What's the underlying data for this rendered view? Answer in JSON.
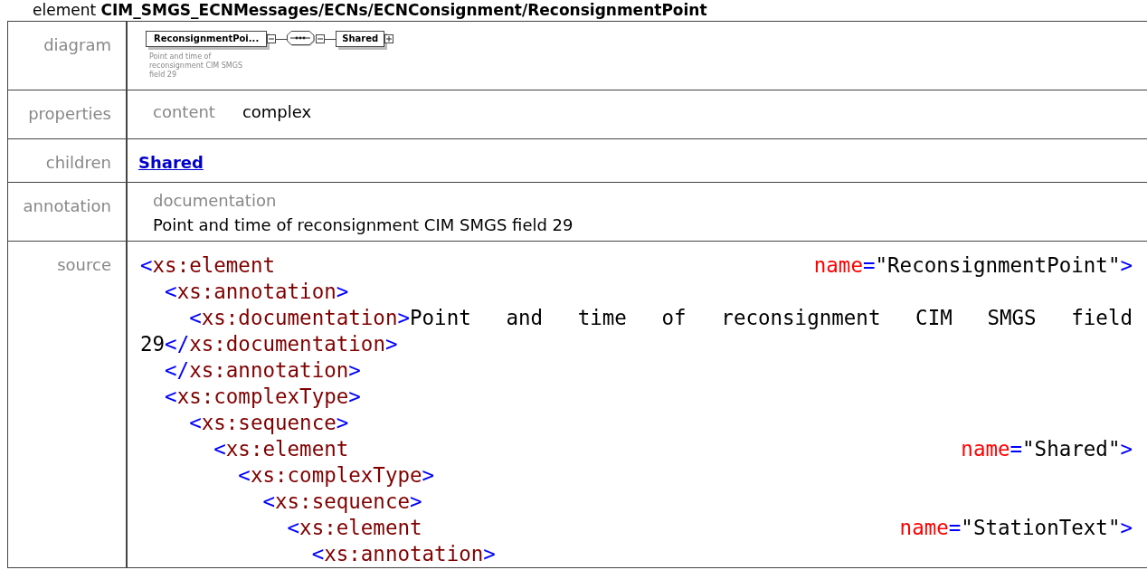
{
  "heading": {
    "kind_label": "element",
    "path": "CIM_SMGS_ECNMessages/ECNs/ECNConsignment/ReconsignmentPoint"
  },
  "rows": [
    {
      "kind": "diagram",
      "label": "diagram",
      "element": {
        "name": "ReconsignmentPoi...",
        "doc": "Point and time of reconsignment CIM SMGS field 29",
        "expanded": true
      },
      "sequence": {
        "expanded": true
      },
      "child": {
        "name": "Shared",
        "expanded": false
      }
    },
    {
      "kind": "properties",
      "label": "properties",
      "items": [
        {
          "key": "content",
          "value": "complex"
        }
      ]
    },
    {
      "kind": "children",
      "label": "children",
      "links": [
        "Shared"
      ]
    },
    {
      "kind": "annotation",
      "label": "annotation",
      "title": "documentation",
      "text": "Point and time of reconsignment CIM SMGS field 29"
    },
    {
      "kind": "source",
      "label": "source",
      "lines": [
        {
          "spread": true,
          "tokens": [
            {
              "kind": "bracket",
              "text": "<"
            },
            {
              "kind": "tag",
              "text": "xs:element"
            },
            {
              "kind": "attr",
              "text": "name"
            },
            {
              "kind": "bracket",
              "text": "="
            },
            {
              "kind": "value",
              "text": "\"ReconsignmentPoint\""
            },
            {
              "kind": "bracket",
              "text": ">"
            }
          ],
          "children": [
            {
              "spread": false,
              "tokens": [
                {
                  "kind": "bracket",
                  "text": "<"
                },
                {
                  "kind": "tag",
                  "text": "xs:annotation"
                },
                {
                  "kind": "bracket",
                  "text": ">"
                }
              ],
              "children": [
                {
                  "spread": true,
                  "tokens": [
                    {
                      "kind": "bracket",
                      "text": "<"
                    },
                    {
                      "kind": "tag",
                      "text": "xs:documentation"
                    },
                    {
                      "kind": "bracket",
                      "text": ">"
                    },
                    {
                      "kind": "value",
                      "text": "Point and time of reconsignment CIM SMGS field"
                    }
                  ],
                  "continuation": [
                    {
                      "kind": "value",
                      "text": "29"
                    },
                    {
                      "kind": "bracket",
                      "text": "</"
                    },
                    {
                      "kind": "tag",
                      "text": "xs:documentation"
                    },
                    {
                      "kind": "bracket",
                      "text": ">"
                    }
                  ]
                }
              ]
            },
            {
              "spread": false,
              "tokens": [
                {
                  "kind": "bracket",
                  "text": "</"
                },
                {
                  "kind": "tag",
                  "text": "xs:annotation"
                },
                {
                  "kind": "bracket",
                  "text": ">"
                }
              ]
            },
            {
              "spread": false,
              "tokens": [
                {
                  "kind": "bracket",
                  "text": "<"
                },
                {
                  "kind": "tag",
                  "text": "xs:complexType"
                },
                {
                  "kind": "bracket",
                  "text": ">"
                }
              ],
              "children": [
                {
                  "spread": false,
                  "tokens": [
                    {
                      "kind": "bracket",
                      "text": "<"
                    },
                    {
                      "kind": "tag",
                      "text": "xs:sequence"
                    },
                    {
                      "kind": "bracket",
                      "text": ">"
                    }
                  ],
                  "children": [
                    {
                      "spread": true,
                      "tokens": [
                        {
                          "kind": "bracket",
                          "text": "<"
                        },
                        {
                          "kind": "tag",
                          "text": "xs:element"
                        },
                        {
                          "kind": "attr",
                          "text": "name"
                        },
                        {
                          "kind": "bracket",
                          "text": "="
                        },
                        {
                          "kind": "value",
                          "text": "\"Shared\""
                        },
                        {
                          "kind": "bracket",
                          "text": ">"
                        }
                      ],
                      "children": [
                        {
                          "spread": false,
                          "tokens": [
                            {
                              "kind": "bracket",
                              "text": "<"
                            },
                            {
                              "kind": "tag",
                              "text": "xs:complexType"
                            },
                            {
                              "kind": "bracket",
                              "text": ">"
                            }
                          ],
                          "children": [
                            {
                              "spread": false,
                              "tokens": [
                                {
                                  "kind": "bracket",
                                  "text": "<"
                                },
                                {
                                  "kind": "tag",
                                  "text": "xs:sequence"
                                },
                                {
                                  "kind": "bracket",
                                  "text": ">"
                                }
                              ],
                              "children": [
                                {
                                  "spread": true,
                                  "tokens": [
                                    {
                                      "kind": "bracket",
                                      "text": "<"
                                    },
                                    {
                                      "kind": "tag",
                                      "text": "xs:element"
                                    },
                                    {
                                      "kind": "attr",
                                      "text": "name"
                                    },
                                    {
                                      "kind": "bracket",
                                      "text": "="
                                    },
                                    {
                                      "kind": "value",
                                      "text": "\"StationText\""
                                    },
                                    {
                                      "kind": "bracket",
                                      "text": ">"
                                    }
                                  ],
                                  "children": [
                                    {
                                      "spread": false,
                                      "tokens": [
                                        {
                                          "kind": "bracket",
                                          "text": "<"
                                        },
                                        {
                                          "kind": "tag",
                                          "text": "xs:annotation"
                                        },
                                        {
                                          "kind": "bracket",
                                          "text": ">"
                                        }
                                      ]
                                    }
                                  ]
                                }
                              ]
                            }
                          ]
                        }
                      ]
                    }
                  ]
                }
              ]
            }
          ]
        }
      ]
    }
  ]
}
